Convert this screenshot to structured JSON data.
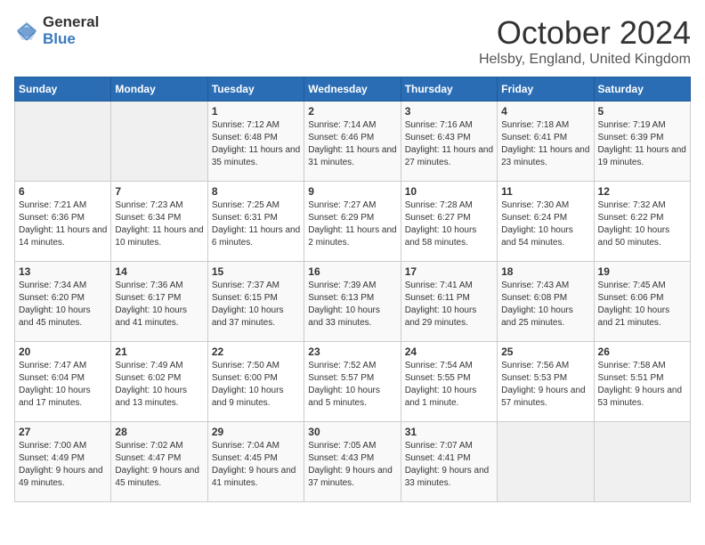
{
  "logo": {
    "general": "General",
    "blue": "Blue"
  },
  "title": "October 2024",
  "subtitle": "Helsby, England, United Kingdom",
  "weekdays": [
    "Sunday",
    "Monday",
    "Tuesday",
    "Wednesday",
    "Thursday",
    "Friday",
    "Saturday"
  ],
  "weeks": [
    [
      {
        "day": "",
        "empty": true
      },
      {
        "day": "",
        "empty": true
      },
      {
        "day": "1",
        "sunrise": "Sunrise: 7:12 AM",
        "sunset": "Sunset: 6:48 PM",
        "daylight": "Daylight: 11 hours and 35 minutes."
      },
      {
        "day": "2",
        "sunrise": "Sunrise: 7:14 AM",
        "sunset": "Sunset: 6:46 PM",
        "daylight": "Daylight: 11 hours and 31 minutes."
      },
      {
        "day": "3",
        "sunrise": "Sunrise: 7:16 AM",
        "sunset": "Sunset: 6:43 PM",
        "daylight": "Daylight: 11 hours and 27 minutes."
      },
      {
        "day": "4",
        "sunrise": "Sunrise: 7:18 AM",
        "sunset": "Sunset: 6:41 PM",
        "daylight": "Daylight: 11 hours and 23 minutes."
      },
      {
        "day": "5",
        "sunrise": "Sunrise: 7:19 AM",
        "sunset": "Sunset: 6:39 PM",
        "daylight": "Daylight: 11 hours and 19 minutes."
      }
    ],
    [
      {
        "day": "6",
        "sunrise": "Sunrise: 7:21 AM",
        "sunset": "Sunset: 6:36 PM",
        "daylight": "Daylight: 11 hours and 14 minutes."
      },
      {
        "day": "7",
        "sunrise": "Sunrise: 7:23 AM",
        "sunset": "Sunset: 6:34 PM",
        "daylight": "Daylight: 11 hours and 10 minutes."
      },
      {
        "day": "8",
        "sunrise": "Sunrise: 7:25 AM",
        "sunset": "Sunset: 6:31 PM",
        "daylight": "Daylight: 11 hours and 6 minutes."
      },
      {
        "day": "9",
        "sunrise": "Sunrise: 7:27 AM",
        "sunset": "Sunset: 6:29 PM",
        "daylight": "Daylight: 11 hours and 2 minutes."
      },
      {
        "day": "10",
        "sunrise": "Sunrise: 7:28 AM",
        "sunset": "Sunset: 6:27 PM",
        "daylight": "Daylight: 10 hours and 58 minutes."
      },
      {
        "day": "11",
        "sunrise": "Sunrise: 7:30 AM",
        "sunset": "Sunset: 6:24 PM",
        "daylight": "Daylight: 10 hours and 54 minutes."
      },
      {
        "day": "12",
        "sunrise": "Sunrise: 7:32 AM",
        "sunset": "Sunset: 6:22 PM",
        "daylight": "Daylight: 10 hours and 50 minutes."
      }
    ],
    [
      {
        "day": "13",
        "sunrise": "Sunrise: 7:34 AM",
        "sunset": "Sunset: 6:20 PM",
        "daylight": "Daylight: 10 hours and 45 minutes."
      },
      {
        "day": "14",
        "sunrise": "Sunrise: 7:36 AM",
        "sunset": "Sunset: 6:17 PM",
        "daylight": "Daylight: 10 hours and 41 minutes."
      },
      {
        "day": "15",
        "sunrise": "Sunrise: 7:37 AM",
        "sunset": "Sunset: 6:15 PM",
        "daylight": "Daylight: 10 hours and 37 minutes."
      },
      {
        "day": "16",
        "sunrise": "Sunrise: 7:39 AM",
        "sunset": "Sunset: 6:13 PM",
        "daylight": "Daylight: 10 hours and 33 minutes."
      },
      {
        "day": "17",
        "sunrise": "Sunrise: 7:41 AM",
        "sunset": "Sunset: 6:11 PM",
        "daylight": "Daylight: 10 hours and 29 minutes."
      },
      {
        "day": "18",
        "sunrise": "Sunrise: 7:43 AM",
        "sunset": "Sunset: 6:08 PM",
        "daylight": "Daylight: 10 hours and 25 minutes."
      },
      {
        "day": "19",
        "sunrise": "Sunrise: 7:45 AM",
        "sunset": "Sunset: 6:06 PM",
        "daylight": "Daylight: 10 hours and 21 minutes."
      }
    ],
    [
      {
        "day": "20",
        "sunrise": "Sunrise: 7:47 AM",
        "sunset": "Sunset: 6:04 PM",
        "daylight": "Daylight: 10 hours and 17 minutes."
      },
      {
        "day": "21",
        "sunrise": "Sunrise: 7:49 AM",
        "sunset": "Sunset: 6:02 PM",
        "daylight": "Daylight: 10 hours and 13 minutes."
      },
      {
        "day": "22",
        "sunrise": "Sunrise: 7:50 AM",
        "sunset": "Sunset: 6:00 PM",
        "daylight": "Daylight: 10 hours and 9 minutes."
      },
      {
        "day": "23",
        "sunrise": "Sunrise: 7:52 AM",
        "sunset": "Sunset: 5:57 PM",
        "daylight": "Daylight: 10 hours and 5 minutes."
      },
      {
        "day": "24",
        "sunrise": "Sunrise: 7:54 AM",
        "sunset": "Sunset: 5:55 PM",
        "daylight": "Daylight: 10 hours and 1 minute."
      },
      {
        "day": "25",
        "sunrise": "Sunrise: 7:56 AM",
        "sunset": "Sunset: 5:53 PM",
        "daylight": "Daylight: 9 hours and 57 minutes."
      },
      {
        "day": "26",
        "sunrise": "Sunrise: 7:58 AM",
        "sunset": "Sunset: 5:51 PM",
        "daylight": "Daylight: 9 hours and 53 minutes."
      }
    ],
    [
      {
        "day": "27",
        "sunrise": "Sunrise: 7:00 AM",
        "sunset": "Sunset: 4:49 PM",
        "daylight": "Daylight: 9 hours and 49 minutes."
      },
      {
        "day": "28",
        "sunrise": "Sunrise: 7:02 AM",
        "sunset": "Sunset: 4:47 PM",
        "daylight": "Daylight: 9 hours and 45 minutes."
      },
      {
        "day": "29",
        "sunrise": "Sunrise: 7:04 AM",
        "sunset": "Sunset: 4:45 PM",
        "daylight": "Daylight: 9 hours and 41 minutes."
      },
      {
        "day": "30",
        "sunrise": "Sunrise: 7:05 AM",
        "sunset": "Sunset: 4:43 PM",
        "daylight": "Daylight: 9 hours and 37 minutes."
      },
      {
        "day": "31",
        "sunrise": "Sunrise: 7:07 AM",
        "sunset": "Sunset: 4:41 PM",
        "daylight": "Daylight: 9 hours and 33 minutes."
      },
      {
        "day": "",
        "empty": true
      },
      {
        "day": "",
        "empty": true
      }
    ]
  ]
}
